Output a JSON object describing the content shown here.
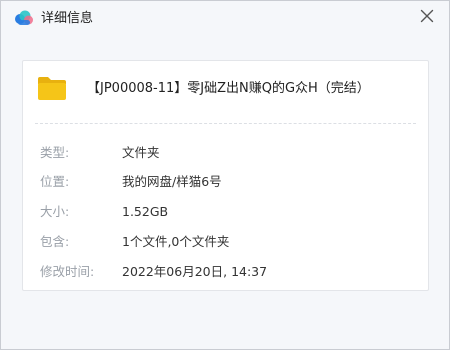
{
  "window": {
    "title": "详细信息",
    "close_glyph": "✕",
    "logo_icon": "baidu-netdisk-cloud-icon"
  },
  "file": {
    "icon": "folder-icon",
    "name": "【JP00008-11】零J础Z出N赚Q的G众H（完结）"
  },
  "details": [
    {
      "label": "类型:",
      "value": "文件夹"
    },
    {
      "label": "位置:",
      "value": "我的网盘/样猫6号"
    },
    {
      "label": "大小:",
      "value": "1.52GB"
    },
    {
      "label": "包含:",
      "value": "1个文件,0个文件夹"
    },
    {
      "label": "修改时间:",
      "value": "2022年06月20日, 14:37"
    }
  ],
  "colors": {
    "folder": "#f5c518",
    "logo_blue": "#2a7de1",
    "logo_teal": "#2bc4c8",
    "logo_pink": "#f06c8a"
  }
}
